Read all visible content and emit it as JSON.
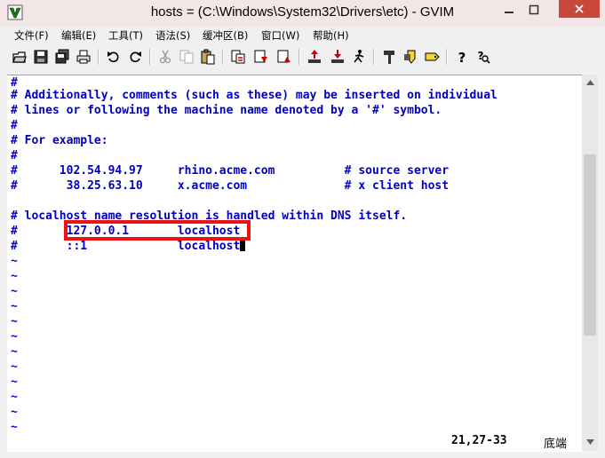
{
  "window": {
    "title": "hosts = (C:\\Windows\\System32\\Drivers\\etc) - GVIM",
    "app_icon": "vim-icon"
  },
  "menu": [
    {
      "label": "文件(F)"
    },
    {
      "label": "编辑(E)"
    },
    {
      "label": "工具(T)"
    },
    {
      "label": "语法(S)"
    },
    {
      "label": "缓冲区(B)"
    },
    {
      "label": "窗口(W)"
    },
    {
      "label": "帮助(H)"
    }
  ],
  "toolbar": [
    {
      "icon": "open-icon"
    },
    {
      "icon": "save-icon"
    },
    {
      "icon": "save-all-icon"
    },
    {
      "icon": "print-icon"
    },
    {
      "icon": "undo-icon"
    },
    {
      "icon": "redo-icon"
    },
    {
      "icon": "cut-icon"
    },
    {
      "icon": "copy-icon"
    },
    {
      "icon": "paste-icon"
    },
    {
      "icon": "replace-icon"
    },
    {
      "icon": "find-next-icon"
    },
    {
      "icon": "find-prev-icon"
    },
    {
      "icon": "load-session-icon"
    },
    {
      "icon": "save-session-icon"
    },
    {
      "icon": "run-script-icon"
    },
    {
      "icon": "make-icon"
    },
    {
      "icon": "run-ctags-icon"
    },
    {
      "icon": "tag-jump-icon"
    },
    {
      "icon": "help-icon"
    },
    {
      "icon": "find-help-icon"
    }
  ],
  "editor": {
    "lines": [
      "#",
      "# Additionally, comments (such as these) may be inserted on individual",
      "# lines or following the machine name denoted by a '#' symbol.",
      "#",
      "# For example:",
      "#",
      "#      102.54.94.97     rhino.acme.com          # source server",
      "#       38.25.63.10     x.acme.com              # x client host",
      "",
      "# localhost name resolution is handled within DNS itself.",
      "#       127.0.0.1       localhost",
      "#       ::1             localhost"
    ],
    "empty_line_marker": "~",
    "empty_line_count": 12
  },
  "status": {
    "position": "21,27-33",
    "scroll": "底端"
  }
}
